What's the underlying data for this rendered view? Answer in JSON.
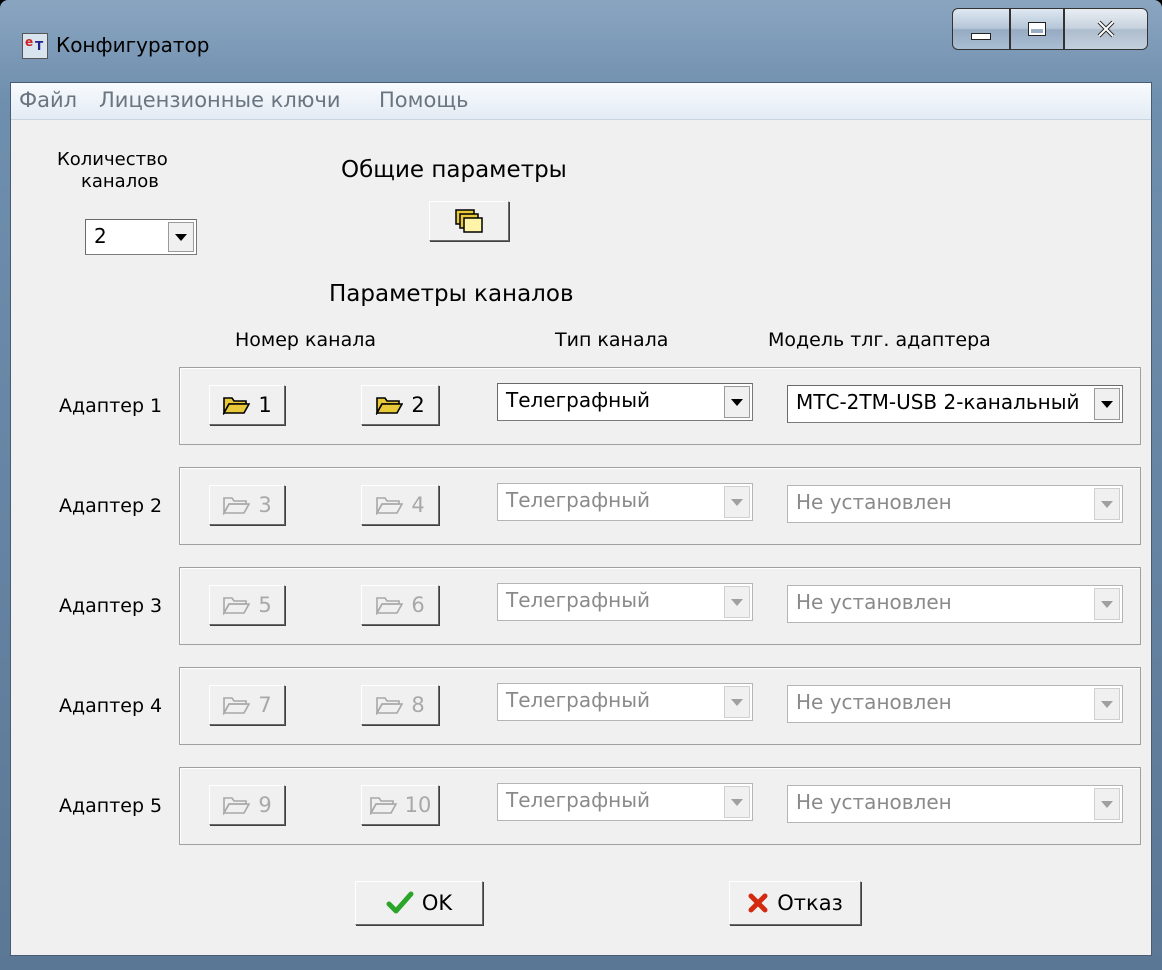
{
  "window": {
    "title": "Конфигуратор",
    "icon": "app-icon",
    "minimize": "minimize-icon",
    "maximize": "maximize-icon",
    "close": "close-icon"
  },
  "menu": [
    "Файл",
    "Лицензионные ключи",
    "Помощь"
  ],
  "channels_count": {
    "label_line1": "Количество",
    "label_line2": "каналов",
    "value": "2"
  },
  "general": {
    "title": "Общие параметры",
    "button_icon": "folders-icon"
  },
  "channels": {
    "title": "Параметры каналов",
    "col_number": "Номер канала",
    "col_type": "Тип канала",
    "col_model": "Модель тлг. адаптера"
  },
  "adapters": [
    {
      "label": "Адаптер 1",
      "ch1": "1",
      "ch2": "2",
      "type": "Телеграфный",
      "model": "МТС-2ТМ-USB 2-канальный",
      "enabled": true
    },
    {
      "label": "Адаптер 2",
      "ch1": "3",
      "ch2": "4",
      "type": "Телеграфный",
      "model": "Не установлен",
      "enabled": false
    },
    {
      "label": "Адаптер 3",
      "ch1": "5",
      "ch2": "6",
      "type": "Телеграфный",
      "model": "Не установлен",
      "enabled": false
    },
    {
      "label": "Адаптер 4",
      "ch1": "7",
      "ch2": "8",
      "type": "Телеграфный",
      "model": "Не установлен",
      "enabled": false
    },
    {
      "label": "Адаптер 5",
      "ch1": "9",
      "ch2": "10",
      "type": "Телеграфный",
      "model": "Не установлен",
      "enabled": false
    }
  ],
  "buttons": {
    "ok": "OK",
    "cancel": "Отказ",
    "ok_icon": "checkmark-icon",
    "cancel_icon": "cross-icon"
  },
  "colors": {
    "enabled_folder": "#e8c93a",
    "checkmark": "#2aa52a",
    "cross": "#d42a10"
  }
}
